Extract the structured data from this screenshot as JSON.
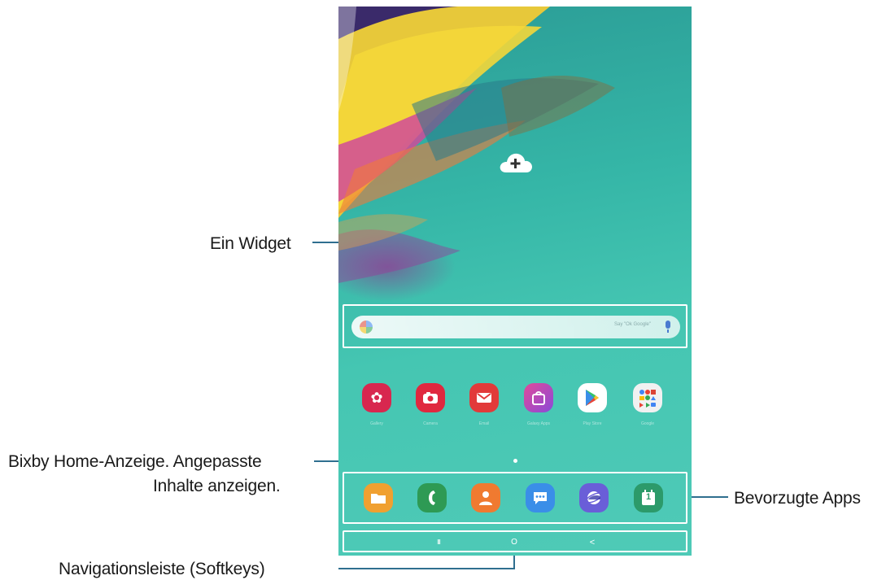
{
  "callouts": {
    "widget": "Ein Widget",
    "bixby_line1": "Bixby Home-Anzeige. Angepasste",
    "bixby_line2": "Inhalte anzeigen.",
    "favorites": "Bevorzugte Apps",
    "navbar": "Navigationsleiste (Softkeys)"
  },
  "search_widget": {
    "placeholder": "Say \"Ok Google\""
  },
  "apps": [
    {
      "label": "Gallery",
      "icon": "gallery-icon",
      "color": "#d8274f"
    },
    {
      "label": "Camera",
      "icon": "camera-icon",
      "color": "#e0283f"
    },
    {
      "label": "Email",
      "icon": "email-icon",
      "color": "#e23a3a"
    },
    {
      "label": "Galaxy Apps",
      "icon": "galaxy-apps-icon",
      "color": "#b648c8"
    },
    {
      "label": "Play Store",
      "icon": "play-store-icon",
      "color": "#ffffff"
    },
    {
      "label": "Google",
      "icon": "google-folder-icon",
      "color": "#f1f1f1"
    }
  ],
  "dock": [
    {
      "icon": "my-files-icon",
      "color": "#f0a030"
    },
    {
      "icon": "phone-icon",
      "color": "#2e9a54"
    },
    {
      "icon": "contacts-icon",
      "color": "#f07a30"
    },
    {
      "icon": "messages-icon",
      "color": "#3a8ee8"
    },
    {
      "icon": "internet-icon",
      "color": "#6a5ed8"
    },
    {
      "icon": "calendar-icon",
      "color": "#2c9a6a"
    }
  ],
  "calendar_day": "1",
  "navbar": {
    "recents": "III",
    "home": "O",
    "back": "<"
  }
}
